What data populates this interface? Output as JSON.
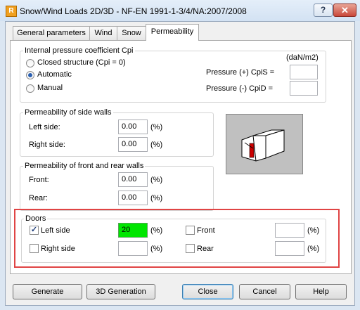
{
  "window": {
    "title": "Snow/Wind Loads 2D/3D - NF-EN 1991-1-3/4/NA:2007/2008",
    "app_icon": "R",
    "help_label": "?",
    "close_label": "✕"
  },
  "tabs": [
    {
      "label": "General parameters"
    },
    {
      "label": "Wind"
    },
    {
      "label": "Snow"
    },
    {
      "label": "Permeability",
      "active": true
    }
  ],
  "internal_pressure": {
    "title": "Internal pressure coefficient Cpi",
    "unit": "(daN/m2)",
    "options": [
      {
        "label": "Closed structure (Cpi = 0)",
        "selected": false
      },
      {
        "label": "Automatic",
        "selected": true
      },
      {
        "label": "Manual",
        "selected": false
      }
    ],
    "pressure_plus_label": "Pressure (+) CpiS =",
    "pressure_plus_value": "",
    "pressure_minus_label": "Pressure (-) CpiD =",
    "pressure_minus_value": ""
  },
  "side_walls": {
    "title": "Permeability of side walls",
    "left_label": "Left side:",
    "left_value": "0.00",
    "right_label": "Right side:",
    "right_value": "0.00",
    "unit": "(%)"
  },
  "front_rear_walls": {
    "title": "Permeability of front and rear walls",
    "front_label": "Front:",
    "front_value": "0.00",
    "rear_label": "Rear:",
    "rear_value": "0.00",
    "unit": "(%)"
  },
  "doors": {
    "title": "Doors",
    "unit": "(%)",
    "left": {
      "label": "Left side",
      "checked": true,
      "value": "20"
    },
    "right": {
      "label": "Right side",
      "checked": false,
      "value": ""
    },
    "front": {
      "label": "Front",
      "checked": false,
      "value": ""
    },
    "rear": {
      "label": "Rear",
      "checked": false,
      "value": ""
    },
    "active_field_color": "#00e600"
  },
  "buttons": {
    "generate": "Generate",
    "generation_3d": "3D Generation",
    "close": "Close",
    "cancel": "Cancel",
    "help": "Help"
  },
  "colors": {
    "highlight_border": "#e04444",
    "door_marker": "#cc0000"
  }
}
